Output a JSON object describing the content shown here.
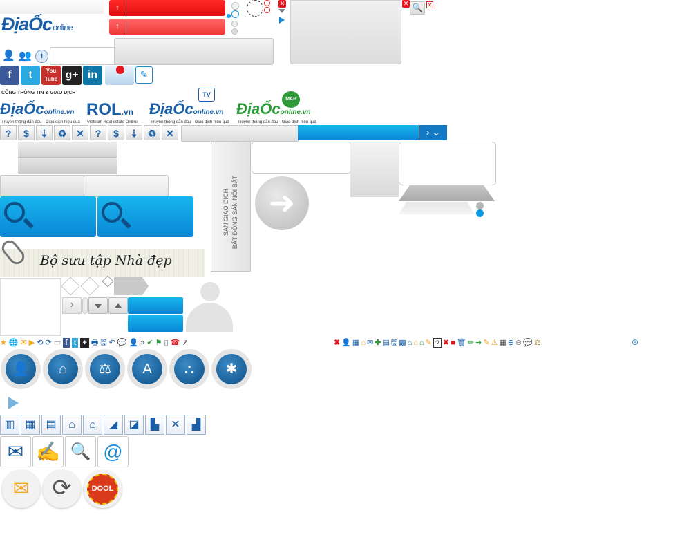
{
  "brand": {
    "logo_main": "ĐịaỐc",
    "logo_main_suffix": "online",
    "portal_caption": "CỔNG THÔNG TIN & GIAO DỊCH",
    "logos": [
      {
        "name": "ĐịaỐc",
        "suffix": "online.vn",
        "tagline": "Truyền thông dẫn đầu - Giao dịch hiệu quả",
        "color": "#1a5fa6"
      },
      {
        "name": "ROL",
        "suffix": ".vn",
        "tagline": "Vietnam Real estate Online",
        "color": "#1a5fa6"
      },
      {
        "name": "ĐịaỐc",
        "suffix": "online.vn",
        "badge": "TV",
        "tagline": "Truyền thông dẫn đầu - Giao dịch hiệu quả",
        "color": "#1a5fa6"
      },
      {
        "name": "ĐịaỐc",
        "suffix": "online.vn",
        "badge": "MAP",
        "tagline": "Truyền thông dẫn đầu - Giao dịch hiệu quả",
        "color": "#2f9a3a"
      }
    ]
  },
  "buttons": {
    "red_top_arrow": "↑",
    "red_bottom_arrow": "↑",
    "play_arrow": "▶",
    "next_arrow": "➜",
    "dropdown_chevrons": "› ⌄"
  },
  "social": [
    {
      "icon": "facebook-icon",
      "glyph": "f",
      "color": "#3b5998"
    },
    {
      "icon": "twitter-icon",
      "glyph": "t",
      "color": "#2aa9e0"
    },
    {
      "icon": "youtube-icon",
      "glyph": "You Tube",
      "color": "#c4302b"
    },
    {
      "icon": "google-plus-icon",
      "glyph": "g+",
      "color": "#222222"
    },
    {
      "icon": "linkedin-icon",
      "glyph": "in",
      "color": "#0e76a8"
    }
  ],
  "toolbar_icons": [
    {
      "icon": "question-icon",
      "glyph": "?"
    },
    {
      "icon": "dollar-icon",
      "glyph": "$"
    },
    {
      "icon": "download-icon",
      "glyph": "⇣"
    },
    {
      "icon": "recycle-icon",
      "glyph": "♻"
    },
    {
      "icon": "tools-icon",
      "glyph": "✕"
    },
    {
      "icon": "question-icon",
      "glyph": "?"
    },
    {
      "icon": "dollar-icon",
      "glyph": "$"
    },
    {
      "icon": "download-icon",
      "glyph": "⇣"
    },
    {
      "icon": "recycle-icon",
      "glyph": "♻"
    },
    {
      "icon": "tools-icon",
      "glyph": "✕"
    }
  ],
  "vertical_banner": {
    "line1": "SÀN GIAO DỊCH",
    "line2": "BẤT ĐỘNG SẢN NỔI BẬT"
  },
  "collection_banner": {
    "text": "Bộ sưu tập Nhà đẹp"
  },
  "property_icons": [
    {
      "icon": "office-building-icon",
      "glyph": "▥"
    },
    {
      "icon": "apartment-icon",
      "glyph": "▦"
    },
    {
      "icon": "condo-icon",
      "glyph": "▤"
    },
    {
      "icon": "house-row-icon",
      "glyph": "⌂"
    },
    {
      "icon": "villa-icon",
      "glyph": "⌂"
    },
    {
      "icon": "land-icon",
      "glyph": "◢"
    },
    {
      "icon": "land-plot-icon",
      "glyph": "◪"
    },
    {
      "icon": "warehouse-icon",
      "glyph": "▙"
    },
    {
      "icon": "farm-icon",
      "glyph": "✕"
    },
    {
      "icon": "factory-icon",
      "glyph": "▟"
    }
  ],
  "service_circles": [
    {
      "icon": "consulting-icon",
      "glyph": "👤"
    },
    {
      "icon": "protection-icon",
      "glyph": "⌂"
    },
    {
      "icon": "legal-scale-icon",
      "glyph": "⚖"
    },
    {
      "icon": "architecture-icon",
      "glyph": "A"
    },
    {
      "icon": "construction-icon",
      "glyph": "⛬"
    },
    {
      "icon": "valuation-icon",
      "glyph": "✱"
    }
  ],
  "small_icons_left": [
    "★",
    "🌐",
    "✉",
    "▶",
    "⟲",
    "⟳",
    "▭",
    "f",
    "t",
    "+",
    "🖶",
    "🖫",
    "↶",
    "💬",
    "👤",
    "»",
    "✔",
    "⚑",
    "▯",
    "☎",
    "↗"
  ],
  "small_icons_right": [
    "✖",
    "👤",
    "▦",
    "⌂",
    "✉",
    "✚",
    "▤",
    "🖫",
    "▩",
    "⌂",
    "⌂",
    "⌂",
    "✎",
    "?",
    "✖",
    "■",
    "🗑",
    "✏",
    "➜",
    "✎",
    "⚠",
    "▦",
    "⊕",
    "⊖",
    "💬",
    "⚖",
    "⊙"
  ],
  "contact_icons": [
    {
      "icon": "mail-icon",
      "glyph": "✉"
    },
    {
      "icon": "document-sign-icon",
      "glyph": "✍"
    },
    {
      "icon": "search-check-icon",
      "glyph": "🔍"
    },
    {
      "icon": "email-at-icon",
      "glyph": "@"
    }
  ],
  "round_icons": [
    {
      "icon": "envelope-icon",
      "glyph": "✉",
      "color": "#f5a623"
    },
    {
      "icon": "home-refresh-icon",
      "glyph": "⟳",
      "color": "#1a8ad4"
    },
    {
      "icon": "dool-badge-icon",
      "glyph": "DOOL",
      "color": "#d93a1b"
    }
  ],
  "colors": {
    "brand_blue": "#1a5fa6",
    "accent_blue": "#0a9ae0",
    "red": "#e3171d",
    "green": "#2f9a3a"
  }
}
